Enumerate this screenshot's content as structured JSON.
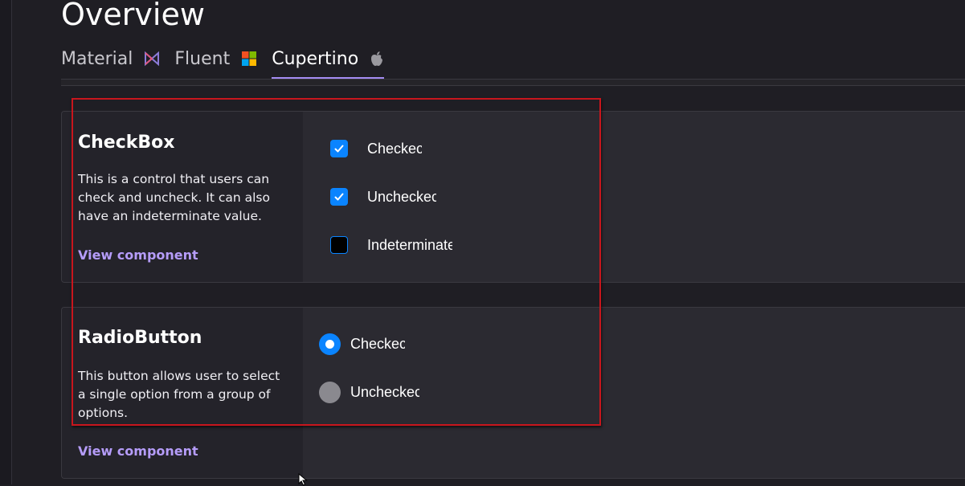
{
  "page": {
    "title": "Overview"
  },
  "tabs": [
    {
      "label": "Material",
      "icon": "material-icon"
    },
    {
      "label": "Fluent",
      "icon": "windows-logo-icon"
    },
    {
      "label": "Cupertino",
      "icon": "apple-logo-icon",
      "active": true
    }
  ],
  "colors": {
    "accent": "#0a84ff",
    "link": "#b59cf9",
    "tab_underline": "#a48cf2",
    "highlight": "#c8161d"
  },
  "cards": {
    "checkbox": {
      "title": "CheckBox",
      "description": "This is a control that users can check and uncheck. It can also have an indeterminate value.",
      "link": "View component",
      "items": [
        {
          "label": "Checkec",
          "checked": true
        },
        {
          "label": "Uncheckec",
          "checked": true
        },
        {
          "label": "Indeterminate",
          "checked": false
        }
      ]
    },
    "radio": {
      "title": "RadioButton",
      "description": "This button allows user to select a single option from a group of options.",
      "link": "View component",
      "items": [
        {
          "label": "Checkec",
          "selected": true
        },
        {
          "label": "Uncheckec",
          "selected": false
        }
      ]
    }
  }
}
